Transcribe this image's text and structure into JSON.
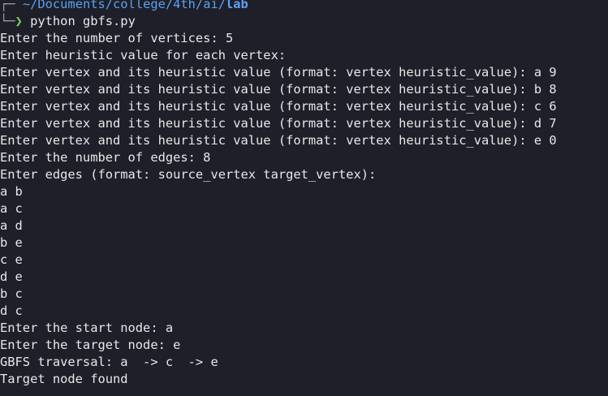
{
  "prompt": {
    "path_base": "~/Documents/college/4th/ai/",
    "path_last": "lab",
    "command": "python gbfs.py"
  },
  "output_lines": [
    "Enter the number of vertices: 5",
    "Enter heuristic value for each vertex:",
    "Enter vertex and its heuristic value (format: vertex heuristic_value): a 9",
    "Enter vertex and its heuristic value (format: vertex heuristic_value): b 8",
    "Enter vertex and its heuristic value (format: vertex heuristic_value): c 6",
    "Enter vertex and its heuristic value (format: vertex heuristic_value): d 7",
    "Enter vertex and its heuristic value (format: vertex heuristic_value): e 0",
    "Enter the number of edges: 8",
    "Enter edges (format: source_vertex target_vertex):",
    "a b",
    "a c",
    "a d",
    "b e",
    "c e",
    "d e",
    "b c",
    "d c",
    "Enter the start node: a",
    "Enter the target node: e",
    "GBFS traversal: a  -> c  -> e",
    "Target node found"
  ],
  "colors": {
    "background": "#1e1f29",
    "path": "#5aa3f0",
    "prompt_arrow": "#7fd15a",
    "text": "#e8e8e8"
  }
}
